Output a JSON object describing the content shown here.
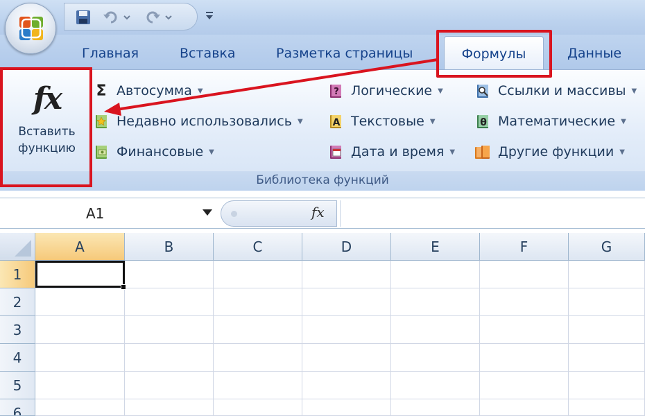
{
  "app": {
    "accent": "#d9141f"
  },
  "tabs": [
    {
      "label": "Главная"
    },
    {
      "label": "Вставка"
    },
    {
      "label": "Разметка страницы"
    },
    {
      "label": "Формулы"
    },
    {
      "label": "Данные"
    }
  ],
  "ribbon": {
    "insert_function": {
      "icon": "fx-icon",
      "label_line1": "Вставить",
      "label_line2": "функцию"
    },
    "col1": [
      {
        "label": "Автосумма",
        "icon": "sigma-icon"
      },
      {
        "label": "Недавно использовались",
        "icon": "star-book-icon"
      },
      {
        "label": "Финансовые",
        "icon": "money-book-icon"
      }
    ],
    "col2": [
      {
        "label": "Логические",
        "icon": "question-book-icon"
      },
      {
        "label": "Текстовые",
        "icon": "text-book-icon"
      },
      {
        "label": "Дата и время",
        "icon": "calendar-book-icon"
      }
    ],
    "col3": [
      {
        "label": "Ссылки и массивы",
        "icon": "magnifier-book-icon"
      },
      {
        "label": "Математические",
        "icon": "theta-book-icon"
      },
      {
        "label": "Другие функции",
        "icon": "books-icon"
      }
    ],
    "group_caption": "Библиотека функций"
  },
  "formula_bar": {
    "name_box": "A1",
    "fx_label": "fx",
    "formula": ""
  },
  "sheet": {
    "columns": [
      "A",
      "B",
      "C",
      "D",
      "E",
      "F",
      "G"
    ],
    "rows": [
      "1",
      "2",
      "3",
      "4",
      "5",
      "6"
    ],
    "active_cell": "A1"
  }
}
